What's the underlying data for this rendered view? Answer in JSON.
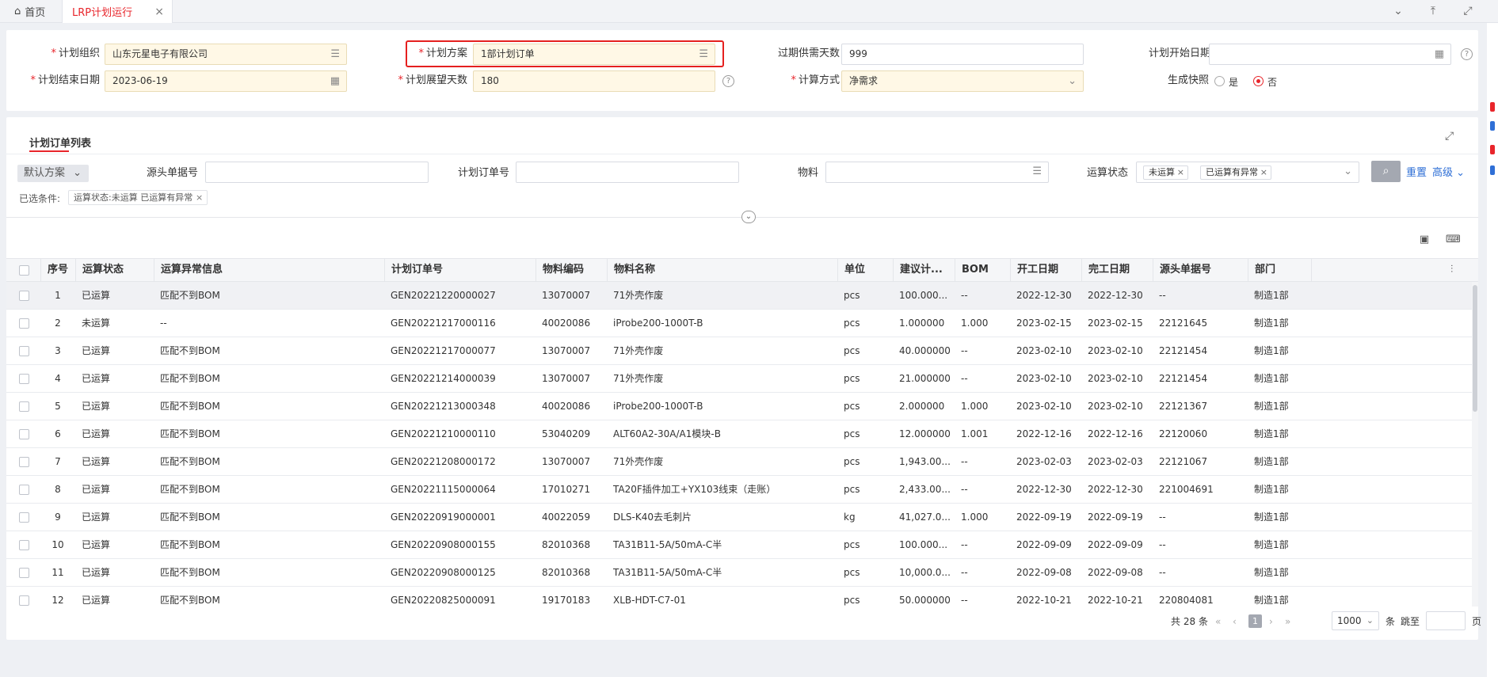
{
  "tabs": {
    "home": "首页",
    "active": "LRP计划运行",
    "close": "×"
  },
  "form": {
    "plan_org_label": "计划组织",
    "plan_org_value": "山东元星电子有限公司",
    "plan_scheme_label": "计划方案",
    "plan_scheme_value": "1部计划订单",
    "overdue_days_label": "过期供需天数",
    "overdue_days_value": "999",
    "plan_start_label": "计划开始日期",
    "plan_start_value": "",
    "plan_end_label": "计划结束日期",
    "plan_end_value": "2023-06-19",
    "horizon_days_label": "计划展望天数",
    "horizon_days_value": "180",
    "calc_method_label": "计算方式",
    "calc_method_value": "净需求",
    "snapshot_label": "生成快照",
    "snapshot_yes": "是",
    "snapshot_no": "否",
    "snapshot_selected": "否"
  },
  "list": {
    "title": "计划订单列表",
    "scheme_label": "默认方案",
    "source_no_label": "源头单据号",
    "plan_order_no_label": "计划订单号",
    "material_label": "物料",
    "calc_status_label": "运算状态",
    "status_chips": [
      "未运算",
      "已运算有异常"
    ],
    "reset_label": "重置",
    "advanced_label": "高级",
    "selected_conditions_label": "已选条件:",
    "selected_condition_value": "运算状态:未运算 已运算有异常"
  },
  "table": {
    "headers": [
      "序号",
      "运算状态",
      "运算异常信息",
      "计划订单号",
      "物料编码",
      "物料名称",
      "单位",
      "建议计...",
      "BOM",
      "开工日期",
      "完工日期",
      "源头单据号",
      "部门"
    ],
    "rows": [
      [
        "1",
        "已运算",
        "匹配不到BOM",
        "GEN20221220000027",
        "13070007",
        "71外壳作废",
        "pcs",
        "100.000...",
        "--",
        "2022-12-30",
        "2022-12-30",
        "--",
        "制造1部"
      ],
      [
        "2",
        "未运算",
        "--",
        "GEN20221217000116",
        "40020086",
        "iProbe200-1000T-B",
        "pcs",
        "1.000000",
        "1.000",
        "2023-02-15",
        "2023-02-15",
        "22121645",
        "制造1部"
      ],
      [
        "3",
        "已运算",
        "匹配不到BOM",
        "GEN20221217000077",
        "13070007",
        "71外壳作废",
        "pcs",
        "40.000000",
        "--",
        "2023-02-10",
        "2023-02-10",
        "22121454",
        "制造1部"
      ],
      [
        "4",
        "已运算",
        "匹配不到BOM",
        "GEN20221214000039",
        "13070007",
        "71外壳作废",
        "pcs",
        "21.000000",
        "--",
        "2023-02-10",
        "2023-02-10",
        "22121454",
        "制造1部"
      ],
      [
        "5",
        "已运算",
        "匹配不到BOM",
        "GEN20221213000348",
        "40020086",
        "iProbe200-1000T-B",
        "pcs",
        "2.000000",
        "1.000",
        "2023-02-10",
        "2023-02-10",
        "22121367",
        "制造1部"
      ],
      [
        "6",
        "已运算",
        "匹配不到BOM",
        "GEN20221210000110",
        "53040209",
        "ALT60A2-30A/A1模块-B",
        "pcs",
        "12.000000",
        "1.001",
        "2022-12-16",
        "2022-12-16",
        "22120060",
        "制造1部"
      ],
      [
        "7",
        "已运算",
        "匹配不到BOM",
        "GEN20221208000172",
        "13070007",
        "71外壳作废",
        "pcs",
        "1,943.00...",
        "--",
        "2023-02-03",
        "2023-02-03",
        "22121067",
        "制造1部"
      ],
      [
        "8",
        "已运算",
        "匹配不到BOM",
        "GEN20221115000064",
        "17010271",
        "TA20F插件加工+YX103线束（走账）",
        "pcs",
        "2,433.00...",
        "--",
        "2022-12-30",
        "2022-12-30",
        "221004691",
        "制造1部"
      ],
      [
        "9",
        "已运算",
        "匹配不到BOM",
        "GEN20220919000001",
        "40022059",
        "DLS-K40去毛刺片",
        "kg",
        "41,027.0...",
        "1.000",
        "2022-09-19",
        "2022-09-19",
        "--",
        "制造1部"
      ],
      [
        "10",
        "已运算",
        "匹配不到BOM",
        "GEN20220908000155",
        "82010368",
        "TA31B11-5A/50mA-C半",
        "pcs",
        "100.000...",
        "--",
        "2022-09-09",
        "2022-09-09",
        "--",
        "制造1部"
      ],
      [
        "11",
        "已运算",
        "匹配不到BOM",
        "GEN20220908000125",
        "82010368",
        "TA31B11-5A/50mA-C半",
        "pcs",
        "10,000.0...",
        "--",
        "2022-09-08",
        "2022-09-08",
        "--",
        "制造1部"
      ],
      [
        "12",
        "已运算",
        "匹配不到BOM",
        "GEN20220825000091",
        "19170183",
        "XLB-HDT-C7-01",
        "pcs",
        "50.000000",
        "--",
        "2022-10-21",
        "2022-10-21",
        "220804081",
        "制造1部"
      ]
    ]
  },
  "pager": {
    "total_prefix": "共",
    "total": "28",
    "total_suffix": "条",
    "current_page": "1",
    "page_size": "1000",
    "page_size_suffix": "条",
    "jump_label": "跳至",
    "page_suffix": "页"
  },
  "colors": {
    "accent": "#e8252b",
    "link": "#2f6fd6",
    "highlight_box": "#e5201f"
  }
}
